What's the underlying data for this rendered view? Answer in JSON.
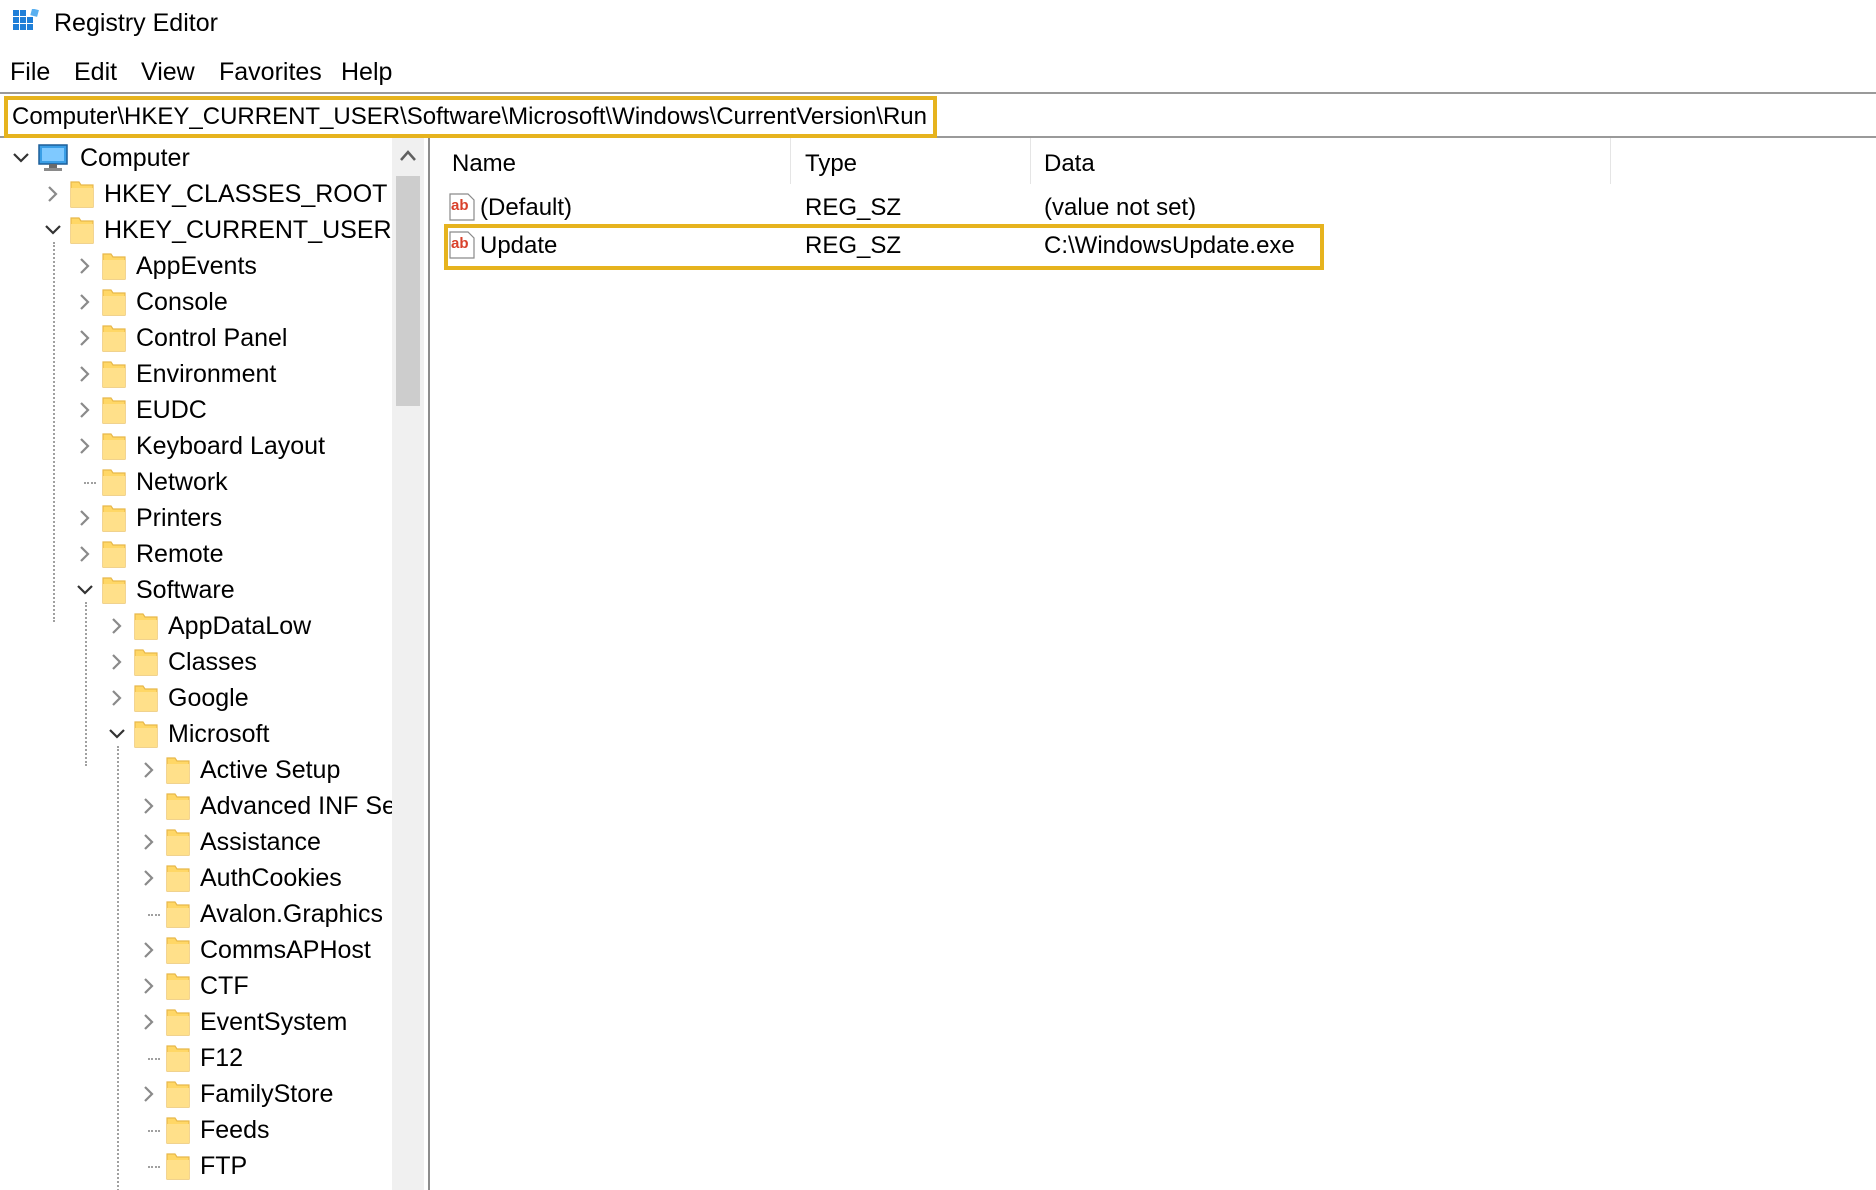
{
  "window": {
    "title": "Registry Editor"
  },
  "menu": [
    "File",
    "Edit",
    "View",
    "Favorites",
    "Help"
  ],
  "address": "Computer\\HKEY_CURRENT_USER\\Software\\Microsoft\\Windows\\CurrentVersion\\Run",
  "tree": [
    {
      "label": "Computer",
      "level": 0,
      "state": "expanded",
      "icon": "computer-icon"
    },
    {
      "label": "HKEY_CLASSES_ROOT",
      "level": 1,
      "state": "collapsed"
    },
    {
      "label": "HKEY_CURRENT_USER",
      "level": 1,
      "state": "expanded"
    },
    {
      "label": "AppEvents",
      "level": 2,
      "state": "collapsed"
    },
    {
      "label": "Console",
      "level": 2,
      "state": "collapsed"
    },
    {
      "label": "Control Panel",
      "level": 2,
      "state": "collapsed"
    },
    {
      "label": "Environment",
      "level": 2,
      "state": "collapsed"
    },
    {
      "label": "EUDC",
      "level": 2,
      "state": "collapsed"
    },
    {
      "label": "Keyboard Layout",
      "level": 2,
      "state": "collapsed"
    },
    {
      "label": "Network",
      "level": 2,
      "state": "leaf"
    },
    {
      "label": "Printers",
      "level": 2,
      "state": "collapsed"
    },
    {
      "label": "Remote",
      "level": 2,
      "state": "collapsed"
    },
    {
      "label": "Software",
      "level": 2,
      "state": "expanded"
    },
    {
      "label": "AppDataLow",
      "level": 3,
      "state": "collapsed"
    },
    {
      "label": "Classes",
      "level": 3,
      "state": "collapsed"
    },
    {
      "label": "Google",
      "level": 3,
      "state": "collapsed"
    },
    {
      "label": "Microsoft",
      "level": 3,
      "state": "expanded"
    },
    {
      "label": "Active Setup",
      "level": 4,
      "state": "collapsed"
    },
    {
      "label": "Advanced INF Set",
      "level": 4,
      "state": "collapsed"
    },
    {
      "label": "Assistance",
      "level": 4,
      "state": "collapsed"
    },
    {
      "label": "AuthCookies",
      "level": 4,
      "state": "collapsed"
    },
    {
      "label": "Avalon.Graphics",
      "level": 4,
      "state": "leaf"
    },
    {
      "label": "CommsAPHost",
      "level": 4,
      "state": "collapsed"
    },
    {
      "label": "CTF",
      "level": 4,
      "state": "collapsed"
    },
    {
      "label": "EventSystem",
      "level": 4,
      "state": "collapsed"
    },
    {
      "label": "F12",
      "level": 4,
      "state": "leaf"
    },
    {
      "label": "FamilyStore",
      "level": 4,
      "state": "collapsed"
    },
    {
      "label": "Feeds",
      "level": 4,
      "state": "leaf"
    },
    {
      "label": "FTP",
      "level": 4,
      "state": "leaf"
    }
  ],
  "list": {
    "columns": [
      "Name",
      "Type",
      "Data"
    ],
    "rows": [
      {
        "name": "(Default)",
        "type": "REG_SZ",
        "data": "(value not set)",
        "highlighted": false
      },
      {
        "name": "Update",
        "type": "REG_SZ",
        "data": "C:\\WindowsUpdate.exe",
        "highlighted": true
      }
    ]
  },
  "colors": {
    "highlight": "#e6b31e",
    "folder": "#ffd766",
    "folder_edge": "#e8b84a",
    "ab_red": "#d9412b"
  }
}
